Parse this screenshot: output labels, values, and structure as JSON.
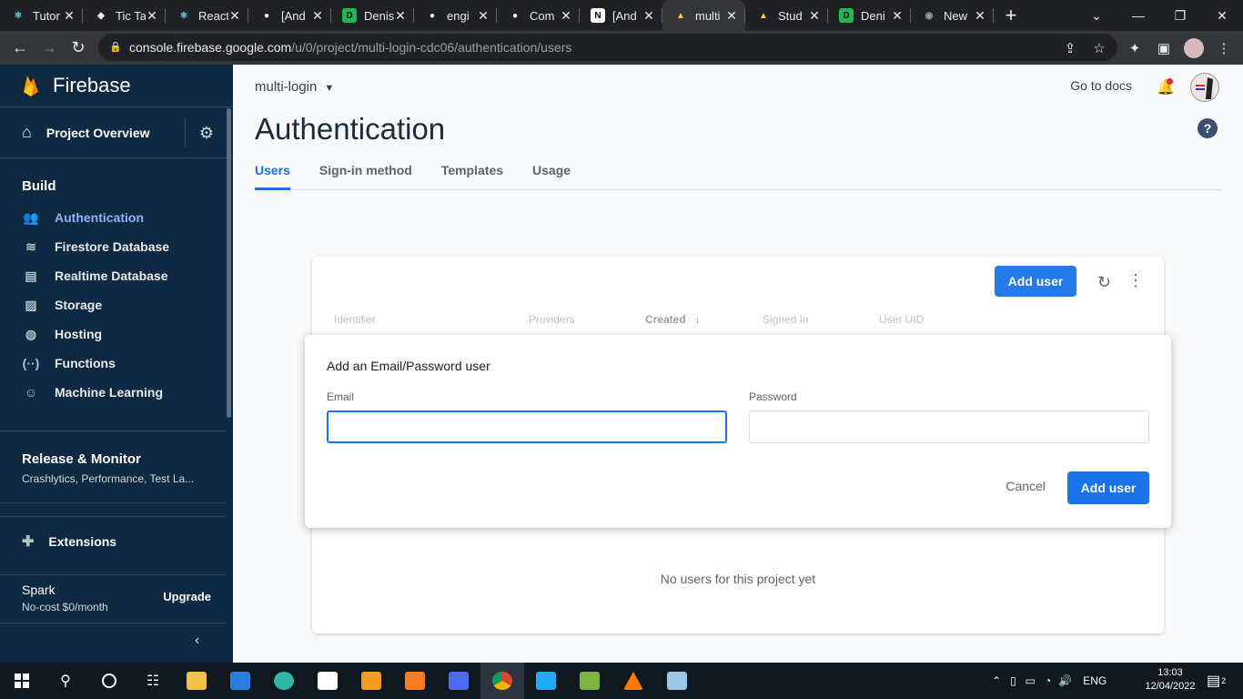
{
  "browser": {
    "tabs": [
      {
        "title": "Tutor",
        "fav": "react",
        "color": "#61dafb"
      },
      {
        "title": "Tic Ta",
        "fav": "code",
        "color": "#ffffff"
      },
      {
        "title": "React",
        "fav": "react",
        "color": "#61dafb"
      },
      {
        "title": "[And",
        "fav": "github",
        "color": "#ffffff"
      },
      {
        "title": "Denis",
        "fav": "D",
        "color": "#1db954"
      },
      {
        "title": "engi",
        "fav": "github",
        "color": "#ffffff"
      },
      {
        "title": "Com",
        "fav": "github",
        "color": "#ffffff"
      },
      {
        "title": "[And",
        "fav": "N",
        "color": "#ffffff"
      },
      {
        "title": "multi",
        "fav": "firebase",
        "color": "#ffca28"
      },
      {
        "title": "Stud",
        "fav": "firebase",
        "color": "#ffca28"
      },
      {
        "title": "Deni",
        "fav": "D",
        "color": "#1db954"
      },
      {
        "title": "New",
        "fav": "chrome",
        "color": "#9aa0a6"
      }
    ],
    "active_tab": 8,
    "url_host": "console.firebase.google.com",
    "url_path": "/u/0/project/multi-login-cdc06/authentication/users"
  },
  "sidebar": {
    "brand": "Firebase",
    "overview": "Project Overview",
    "build_heading": "Build",
    "items": [
      {
        "label": "Authentication",
        "icon": "people-icon",
        "glyph": "👥",
        "active": true
      },
      {
        "label": "Firestore Database",
        "icon": "firestore-icon",
        "glyph": "≋",
        "active": false
      },
      {
        "label": "Realtime Database",
        "icon": "database-icon",
        "glyph": "▤",
        "active": false
      },
      {
        "label": "Storage",
        "icon": "image-icon",
        "glyph": "▨",
        "active": false
      },
      {
        "label": "Hosting",
        "icon": "globe-icon",
        "glyph": "◍",
        "active": false
      },
      {
        "label": "Functions",
        "icon": "functions-icon",
        "glyph": "(··)",
        "active": false
      },
      {
        "label": "Machine Learning",
        "icon": "robot-icon",
        "glyph": "☺",
        "active": false
      }
    ],
    "release_heading": "Release & Monitor",
    "release_sub": "Crashlytics, Performance, Test La...",
    "extensions": "Extensions",
    "plan": "Spark",
    "plan_cost": "No-cost $0/month",
    "upgrade": "Upgrade"
  },
  "header": {
    "project": "multi-login",
    "docs": "Go to docs",
    "title": "Authentication",
    "tabs": [
      "Users",
      "Sign-in method",
      "Templates",
      "Usage"
    ],
    "active_tab": 0
  },
  "users_card": {
    "add_user": "Add user",
    "columns": [
      "Identifier",
      "Providers",
      "Created",
      "Signed In",
      "User UID"
    ],
    "empty": "No users for this project yet"
  },
  "dialog": {
    "title": "Add an Email/Password user",
    "email_label": "Email",
    "email_value": "",
    "password_label": "Password",
    "password_value": "",
    "cancel": "Cancel",
    "add": "Add user"
  },
  "taskbar": {
    "lang": "ENG",
    "time": "13:03",
    "date": "12/04/2022",
    "notifications": "2"
  },
  "colors": {
    "sidebar_bg": "#0f2942",
    "accent": "#1a73e8",
    "active_nav": "#8ab4f8"
  }
}
